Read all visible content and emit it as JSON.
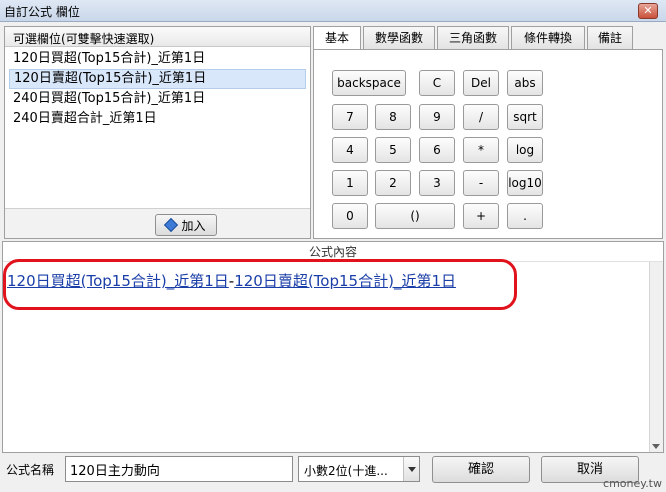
{
  "window": {
    "title": "自訂公式 欄位",
    "close_glyph": "✕"
  },
  "field_list": {
    "header": "可選欄位(可雙擊快速選取)",
    "items": [
      "120日買超(Top15合計)_近第1日",
      "120日賣超(Top15合計)_近第1日",
      "240日買超(Top15合計)_近第1日",
      "240日賣超合計_近第1日"
    ],
    "selected_index": 1,
    "add_label": "加入"
  },
  "tabs": [
    "基本",
    "數學函數",
    "三角函數",
    "條件轉換",
    "備註"
  ],
  "keypad": {
    "row1": [
      "backspace",
      "C",
      "Del",
      "abs"
    ],
    "row2": [
      "7",
      "8",
      "9",
      "/",
      "sqrt"
    ],
    "row3": [
      "4",
      "5",
      "6",
      "*",
      "log"
    ],
    "row4": [
      "1",
      "2",
      "3",
      "-",
      "log10"
    ],
    "row5": [
      "0",
      "()",
      "+",
      "."
    ]
  },
  "formula": {
    "header": "公式內容",
    "term1": "120日買超(Top15合計)_近第1日",
    "operator": "-",
    "term2": "120日賣超(Top15合計)_近第1日"
  },
  "bottom": {
    "name_label": "公式名稱",
    "name_value": "120日主力動向",
    "decimal_value": "小數2位(十進...",
    "confirm_label": "確認",
    "cancel_label": "取消"
  },
  "watermark": "cmoney.tw",
  "colors": {
    "highlight": "#e0121c",
    "link": "#1a3ea8",
    "selection": "#d8e7fa"
  }
}
